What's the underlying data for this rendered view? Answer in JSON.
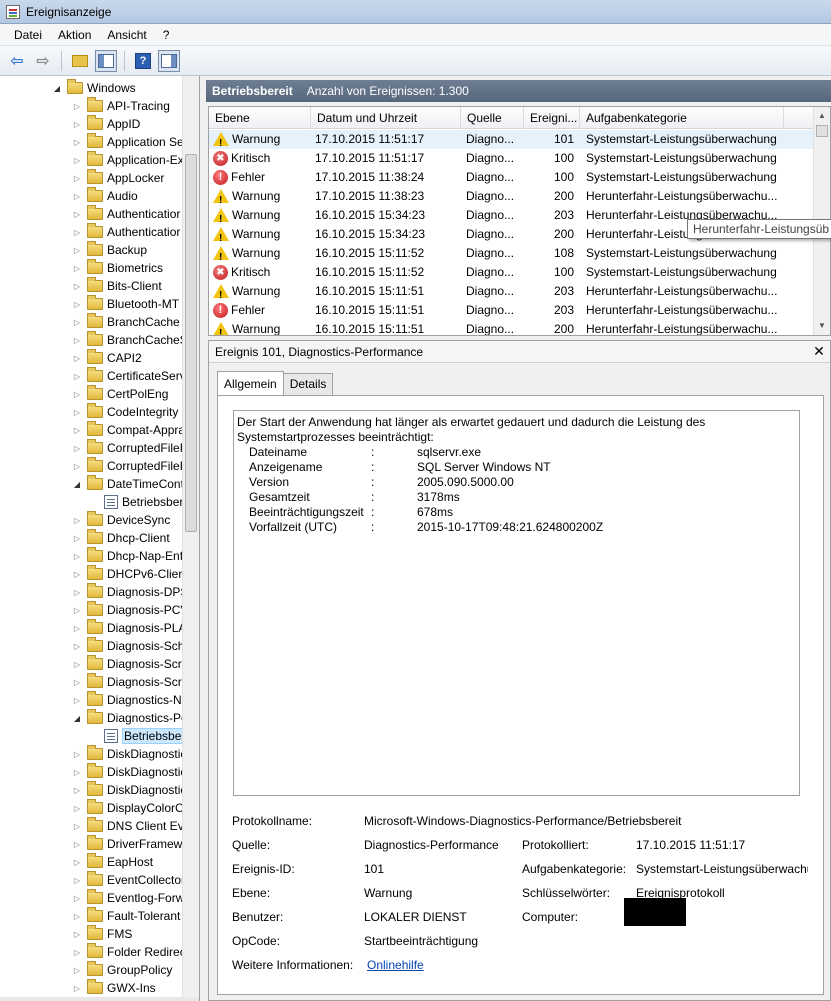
{
  "window": {
    "title": "Ereignisanzeige"
  },
  "menu": [
    "Datei",
    "Aktion",
    "Ansicht",
    "?"
  ],
  "tree": {
    "root": "Windows",
    "items": [
      {
        "label": "API-Tracing"
      },
      {
        "label": "AppID"
      },
      {
        "label": "Application Se"
      },
      {
        "label": "Application-Ex"
      },
      {
        "label": "AppLocker"
      },
      {
        "label": "Audio"
      },
      {
        "label": "Authenticatior"
      },
      {
        "label": "Authenticatior"
      },
      {
        "label": "Backup"
      },
      {
        "label": "Biometrics"
      },
      {
        "label": "Bits-Client"
      },
      {
        "label": "Bluetooth-MT"
      },
      {
        "label": "BranchCache"
      },
      {
        "label": "BranchCacheS"
      },
      {
        "label": "CAPI2"
      },
      {
        "label": "CertificateServ"
      },
      {
        "label": "CertPolEng"
      },
      {
        "label": "CodeIntegrity"
      },
      {
        "label": "Compat-Appra"
      },
      {
        "label": "CorruptedFileF"
      },
      {
        "label": "CorruptedFileF"
      },
      {
        "label": "DateTimeCont"
      },
      {
        "label": "Betriebsber"
      },
      {
        "label": "DeviceSync"
      },
      {
        "label": "Dhcp-Client"
      },
      {
        "label": "Dhcp-Nap-Enf"
      },
      {
        "label": "DHCPv6-Clien"
      },
      {
        "label": "Diagnosis-DPS"
      },
      {
        "label": "Diagnosis-PCV"
      },
      {
        "label": "Diagnosis-PLA"
      },
      {
        "label": "Diagnosis-Sch"
      },
      {
        "label": "Diagnosis-Scri"
      },
      {
        "label": "Diagnosis-Scri"
      },
      {
        "label": "Diagnostics-N"
      },
      {
        "label": "Diagnostics-Pe"
      },
      {
        "label": "Betriebsber"
      },
      {
        "label": "DiskDiagnostic"
      },
      {
        "label": "DiskDiagnostic"
      },
      {
        "label": "DiskDiagnostic"
      },
      {
        "label": "DisplayColorC"
      },
      {
        "label": "DNS Client Eve"
      },
      {
        "label": "DriverFramewo"
      },
      {
        "label": "EapHost"
      },
      {
        "label": "EventCollector"
      },
      {
        "label": "Eventlog-Forw"
      },
      {
        "label": "Fault-Tolerant"
      },
      {
        "label": "FMS"
      },
      {
        "label": "Folder Redirect"
      },
      {
        "label": "GroupPolicy"
      },
      {
        "label": "GWX-Ins"
      }
    ]
  },
  "header": {
    "title": "Betriebsbereit",
    "count": "Anzahl von Ereignissen: 1.300"
  },
  "events": {
    "columns": [
      "Ebene",
      "Datum und Uhrzeit",
      "Quelle",
      "Ereigni...",
      "Aufgabenkategorie"
    ],
    "rows": [
      {
        "icon": "warning-icon",
        "level": "Warnung",
        "date": "17.10.2015 11:51:17",
        "source": "Diagno...",
        "id": "101",
        "category": "Systemstart-Leistungsüberwachung"
      },
      {
        "icon": "critical-icon",
        "level": "Kritisch",
        "date": "17.10.2015 11:51:17",
        "source": "Diagno...",
        "id": "100",
        "category": "Systemstart-Leistungsüberwachung"
      },
      {
        "icon": "error-icon",
        "level": "Fehler",
        "date": "17.10.2015 11:38:24",
        "source": "Diagno...",
        "id": "100",
        "category": "Systemstart-Leistungsüberwachung"
      },
      {
        "icon": "warning-icon",
        "level": "Warnung",
        "date": "17.10.2015 11:38:23",
        "source": "Diagno...",
        "id": "200",
        "category": "Herunterfahr-Leistungsüberwachu..."
      },
      {
        "icon": "warning-icon",
        "level": "Warnung",
        "date": "16.10.2015 15:34:23",
        "source": "Diagno...",
        "id": "203",
        "category": "Herunterfahr-Leistungsüberwachu..."
      },
      {
        "icon": "warning-icon",
        "level": "Warnung",
        "date": "16.10.2015 15:34:23",
        "source": "Diagno...",
        "id": "200",
        "category": "Herunterfahr-Leistungsüberwachu..."
      },
      {
        "icon": "warning-icon",
        "level": "Warnung",
        "date": "16.10.2015 15:11:52",
        "source": "Diagno...",
        "id": "108",
        "category": "Systemstart-Leistungsüberwachung"
      },
      {
        "icon": "critical-icon",
        "level": "Kritisch",
        "date": "16.10.2015 15:11:52",
        "source": "Diagno...",
        "id": "100",
        "category": "Systemstart-Leistungsüberwachung"
      },
      {
        "icon": "warning-icon",
        "level": "Warnung",
        "date": "16.10.2015 15:11:51",
        "source": "Diagno...",
        "id": "203",
        "category": "Herunterfahr-Leistungsüberwachu..."
      },
      {
        "icon": "error-icon",
        "level": "Fehler",
        "date": "16.10.2015 15:11:51",
        "source": "Diagno...",
        "id": "203",
        "category": "Herunterfahr-Leistungsüberwachu..."
      },
      {
        "icon": "warning-icon",
        "level": "Warnung",
        "date": "16.10.2015 15:11:51",
        "source": "Diagno...",
        "id": "200",
        "category": "Herunterfahr-Leistungsüberwachu..."
      }
    ]
  },
  "tooltip": "Herunterfahr-Leistungsüb",
  "detail": {
    "title": "Ereignis 101, Diagnostics-Performance",
    "tabs": [
      "Allgemein",
      "Details"
    ],
    "message": "Der Start der Anwendung hat länger als erwartet gedauert und dadurch die Leistung des Systemstartprozesses beeinträchtigt:",
    "pairs": [
      {
        "k": "Dateiname",
        "v": "sqlservr.exe"
      },
      {
        "k": "Anzeigename",
        "v": "SQL Server Windows NT"
      },
      {
        "k": "Version",
        "v": "2005.090.5000.00"
      },
      {
        "k": "Gesamtzeit",
        "v": "3178ms"
      },
      {
        "k": "Beeinträchtigungszeit",
        "v": "678ms"
      },
      {
        "k": "Vorfallzeit (UTC)",
        "v": "2015-10-17T09:48:21.624800200Z"
      }
    ],
    "colon": ":",
    "props": {
      "protokollname_label": "Protokollname:",
      "protokollname": "Microsoft-Windows-Diagnostics-Performance/Betriebsbereit",
      "quelle_label": "Quelle:",
      "quelle": "Diagnostics-Performance",
      "protokolliert_label": "Protokolliert:",
      "protokolliert": "17.10.2015 11:51:17",
      "ereignisid_label": "Ereignis-ID:",
      "ereignisid": "101",
      "aufgabe_label": "Aufgabenkategorie:",
      "aufgabe": "Systemstart-Leistungsüberwachu",
      "ebene_label": "Ebene:",
      "ebene": "Warnung",
      "schluessel_label": "Schlüsselwörter:",
      "schluessel": "Ereignisprotokoll",
      "benutzer_label": "Benutzer:",
      "benutzer": "LOKALER DIENST",
      "computer_label": "Computer:",
      "opcode_label": "OpCode:",
      "opcode": "Startbeeinträchtigung",
      "info_label": "Weitere Informationen:",
      "info_link": "Onlinehilfe"
    }
  }
}
